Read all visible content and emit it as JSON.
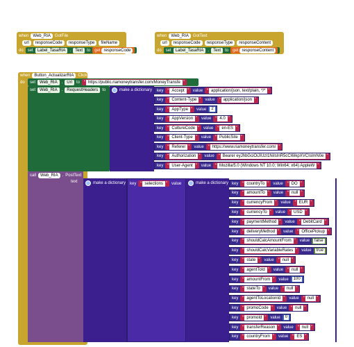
{
  "gotfile": {
    "when": "when",
    "component": "Web_RIA",
    "event": "GotFile",
    "params": [
      "url",
      "responseCode",
      "responseType",
      "fileName"
    ],
    "do": "do",
    "set": "set",
    "target": "Label_TasaRIA",
    "prop": "Text",
    "to": "to",
    "get": "get",
    "getvar": "responseCode"
  },
  "gottext": {
    "when": "when",
    "component": "Web_RIA",
    "event": "GotText",
    "params": [
      "url",
      "responseCode",
      "responseType",
      "responseContent"
    ],
    "do": "do",
    "set": "set",
    "target": "Label_TasaRIA",
    "prop": "Text",
    "to": "to",
    "get": "get",
    "getvar": "responseContent"
  },
  "click": {
    "when": "when",
    "component": "Button_ActualizarRIA",
    "event": "Click",
    "do": "do",
    "set1": {
      "set": "set",
      "comp": "Web_RIA",
      "prop": "Url",
      "to": "to",
      "value": "https://public.riamoneytransfer.com/MoneyTransfe"
    },
    "set2": {
      "set": "set",
      "comp": "Web_RIA",
      "prop": "RequestHeaders",
      "to": "to",
      "make": "make a dictionary"
    },
    "key": "key",
    "value": "value",
    "headers": [
      {
        "k": "Accept",
        "v": "application/json, text/plain, */*",
        "t": "str"
      },
      {
        "k": "Content-Type",
        "v": "application/json",
        "t": "str"
      },
      {
        "k": "AppType",
        "v": "2",
        "t": "num"
      },
      {
        "k": "AppVersion",
        "v": "4.0",
        "t": "str"
      },
      {
        "k": "CultureCode",
        "v": "en-ES",
        "t": "str"
      },
      {
        "k": "Client-Type",
        "v": "PublicSite",
        "t": "str"
      },
      {
        "k": "Referer",
        "v": "https://www.riamoneytransfer.com/",
        "t": "str"
      },
      {
        "k": "Authorization",
        "v": "Bearer eyJhbGciOiJIUzI1NiIsInR5cCI6IkpXVCIsImN0e",
        "t": "str"
      },
      {
        "k": "User-Agent",
        "v": "Mozilla/5.0 (Windows NT 10.0; Win64; x64) AppleW",
        "t": "str"
      }
    ],
    "call": "call",
    "callcomp": "Web_RIA",
    "callmethod": "PostText",
    "text": "text",
    "make": "make a dictionary",
    "outerkey": "selections",
    "body": [
      {
        "k": "countryTo",
        "v": "DO",
        "t": "str"
      },
      {
        "k": "amountTo",
        "v": "null",
        "t": "str"
      },
      {
        "k": "currencyFrom",
        "v": "EUR",
        "t": "str"
      },
      {
        "k": "currencyTo",
        "v": "USD",
        "t": "str"
      },
      {
        "k": "paymentMethod",
        "v": "DebitCard",
        "t": "str"
      },
      {
        "k": "deliveryMethod",
        "v": "OfficePickup",
        "t": "str"
      },
      {
        "k": "shouldCalcAmountFrom",
        "v": "false",
        "t": "bool"
      },
      {
        "k": "shouldCalcVariableRates",
        "v": "true",
        "t": "bool"
      },
      {
        "k": "state",
        "v": "null",
        "t": "str"
      },
      {
        "k": "agentToId",
        "v": "null",
        "t": "str"
      },
      {
        "k": "amountFrom",
        "v": "100",
        "t": "num"
      },
      {
        "k": "stateTo",
        "v": "null",
        "t": "str"
      },
      {
        "k": "agentToLocationId",
        "v": "null",
        "t": "str"
      },
      {
        "k": "promoCode",
        "v": "null",
        "t": "str"
      },
      {
        "k": "promoId",
        "v": "0",
        "t": "num"
      },
      {
        "k": "transferReason",
        "v": "null",
        "t": "str"
      },
      {
        "k": "countryFrom",
        "v": "ES",
        "t": "str"
      }
    ],
    "colors": {
      "event": "#c8a52e",
      "setter": "#1f6b3a",
      "dict": "#3b1f8f",
      "text": "#b8264e",
      "call": "#7a4d8c",
      "number": "#3b5fc0",
      "logic": "#5c8a3a"
    }
  }
}
